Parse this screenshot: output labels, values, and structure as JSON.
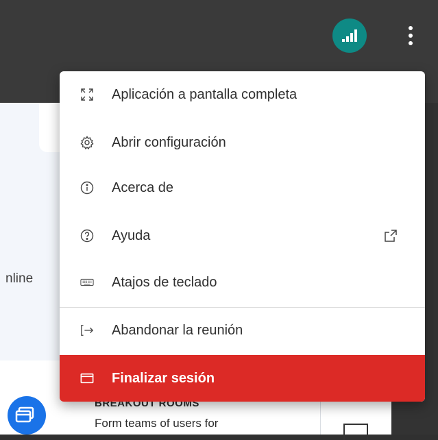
{
  "background": {
    "online_text": "nline",
    "breakout_title": "BREAKOUT ROOMS",
    "breakout_desc": "Form teams of users for"
  },
  "topbar": {
    "connection_icon": "signal-bars-icon",
    "menu_icon": "kebab-menu-icon"
  },
  "menu": {
    "items": [
      {
        "label": "Aplicación a pantalla completa",
        "icon": "fullscreen-icon"
      },
      {
        "label": "Abrir configuración",
        "icon": "gear-icon"
      },
      {
        "label": "Acerca de",
        "icon": "info-icon"
      },
      {
        "label": "Ayuda",
        "icon": "help-icon",
        "trailing_icon": "external-link-icon"
      },
      {
        "label": "Atajos de teclado",
        "icon": "keyboard-icon"
      },
      {
        "label": "Abandonar la reunión",
        "icon": "exit-icon"
      },
      {
        "label": "Finalizar sesión",
        "icon": "end-session-icon"
      }
    ]
  },
  "colors": {
    "accent_teal": "#0e8a85",
    "danger_red": "#dc2a26",
    "breakout_blue": "#1a73e8"
  }
}
